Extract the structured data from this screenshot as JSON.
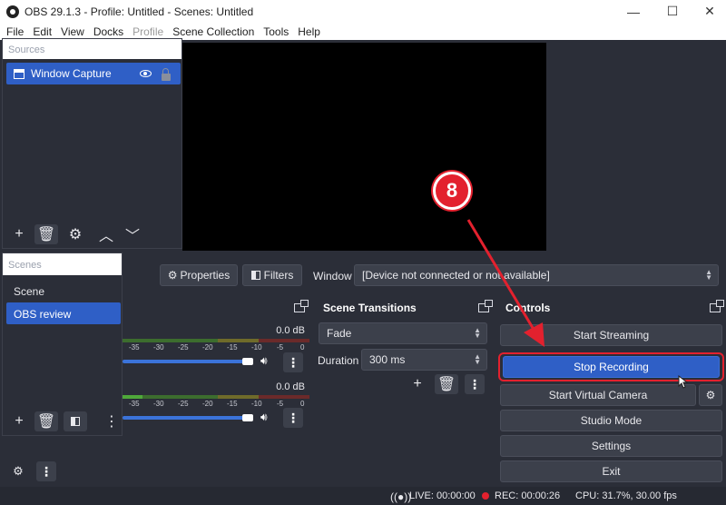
{
  "window": {
    "title": "OBS 29.1.3 - Profile: Untitled - Scenes: Untitled",
    "minimize": "—",
    "maximize": "☐",
    "close": "✕"
  },
  "menu": [
    "File",
    "Edit",
    "View",
    "Docks",
    "Profile",
    "Scene Collection",
    "Tools",
    "Help"
  ],
  "sources": {
    "header": "Sources",
    "items": [
      {
        "label": "Window Capture"
      }
    ]
  },
  "scenes": {
    "header": "Scenes",
    "items": [
      {
        "label": "Scene"
      },
      {
        "label": "OBS review"
      }
    ]
  },
  "source_toolbar": {
    "properties": "Properties",
    "filters": "Filters",
    "window_label": "Window",
    "window_value": "[Device not connected or not available]"
  },
  "mixer": {
    "channels": [
      {
        "db": "0.0 dB",
        "ticks": [
          "-35",
          "-30",
          "-25",
          "-20",
          "-15",
          "-10",
          "-5",
          "0"
        ]
      },
      {
        "db": "0.0 dB",
        "ticks": [
          "-35",
          "-30",
          "-25",
          "-20",
          "-15",
          "-10",
          "-5",
          "0"
        ]
      }
    ]
  },
  "transitions": {
    "title": "Scene Transitions",
    "selected": "Fade",
    "duration_label": "Duration",
    "duration_value": "300 ms"
  },
  "controls": {
    "title": "Controls",
    "buttons": [
      "Start Streaming",
      "Stop Recording",
      "Start Virtual Camera",
      "Studio Mode",
      "Settings",
      "Exit"
    ]
  },
  "status": {
    "live": "LIVE: 00:00:00",
    "rec": "REC: 00:00:26",
    "cpu": "CPU: 31.7%, 30.00 fps"
  },
  "annotation": {
    "step": "8"
  },
  "colors": {
    "accent": "#2f5fc6",
    "highlight": "#e3212e",
    "bg": "#2b2e38"
  }
}
